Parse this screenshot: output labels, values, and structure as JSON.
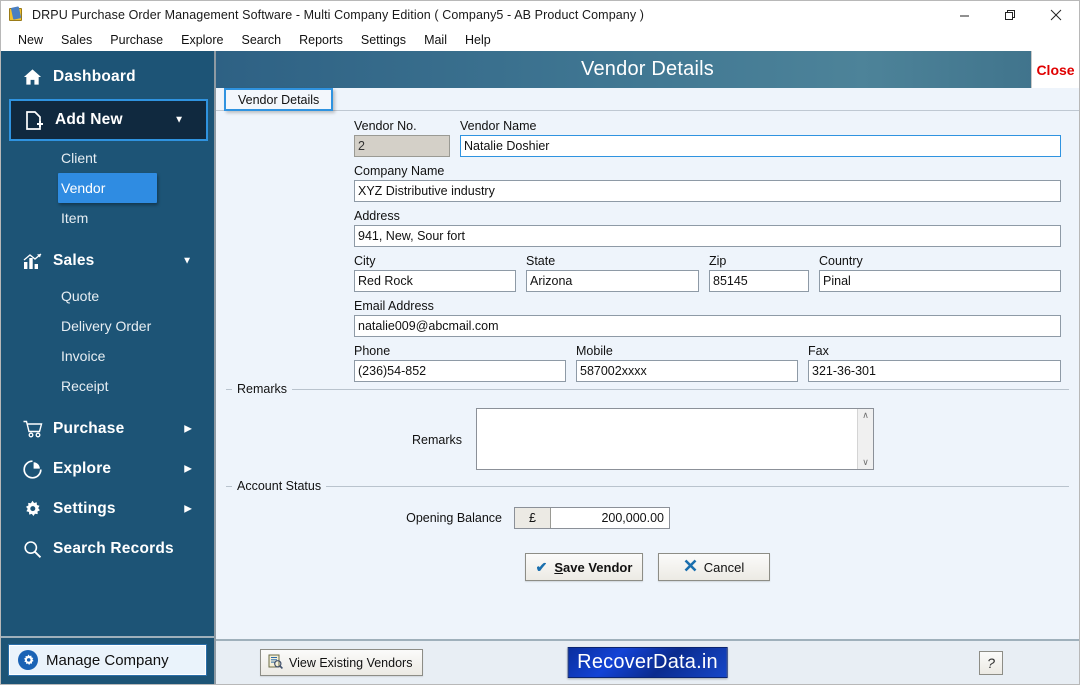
{
  "window": {
    "title": "DRPU Purchase Order Management Software - Multi Company Edition ( Company5 - AB Product Company )",
    "app_icon": "app-icon",
    "minimize": "minimize-icon",
    "maximize": "restore-icon",
    "close": "close-icon"
  },
  "menubar": {
    "items": [
      {
        "label": "New"
      },
      {
        "label": "Sales"
      },
      {
        "label": "Purchase"
      },
      {
        "label": "Explore"
      },
      {
        "label": "Search"
      },
      {
        "label": "Reports"
      },
      {
        "label": "Settings"
      },
      {
        "label": "Mail"
      },
      {
        "label": "Help"
      }
    ]
  },
  "sidebar": {
    "items": [
      {
        "label": "Dashboard",
        "icon": "home-icon",
        "type": "top",
        "caret": "",
        "selected": false
      },
      {
        "label": "Add New",
        "icon": "add-document-icon",
        "type": "top",
        "caret": "▼",
        "selected": true
      },
      {
        "label": "Client",
        "icon": "",
        "type": "sub",
        "active": false
      },
      {
        "label": "Vendor",
        "icon": "",
        "type": "sub",
        "active": true
      },
      {
        "label": "Item",
        "icon": "",
        "type": "sub",
        "active": false
      },
      {
        "label": "Sales",
        "icon": "chart-icon",
        "type": "top",
        "caret": "▼",
        "selected": false
      },
      {
        "label": "Quote",
        "icon": "",
        "type": "sub",
        "active": false
      },
      {
        "label": "Delivery Order",
        "icon": "",
        "type": "sub",
        "active": false
      },
      {
        "label": "Invoice",
        "icon": "",
        "type": "sub",
        "active": false
      },
      {
        "label": "Receipt",
        "icon": "",
        "type": "sub",
        "active": false
      },
      {
        "label": "Purchase",
        "icon": "cart-icon",
        "type": "top",
        "caret": "▶",
        "selected": false
      },
      {
        "label": "Explore",
        "icon": "pie-icon",
        "type": "top",
        "caret": "▶",
        "selected": false
      },
      {
        "label": "Settings",
        "icon": "gear-icon",
        "type": "top",
        "caret": "▶",
        "selected": false
      },
      {
        "label": "Search Records",
        "icon": "search-icon",
        "type": "top",
        "caret": "",
        "selected": false
      }
    ],
    "manage_company": {
      "label": "Manage Company",
      "icon": "gear-icon"
    }
  },
  "panel": {
    "title": "Vendor Details",
    "close_label": "Close",
    "tab_label": "Vendor Details"
  },
  "form": {
    "vendor_no": {
      "label": "Vendor No.",
      "value": "2",
      "readonly": true
    },
    "vendor_name": {
      "label": "Vendor Name",
      "value": "Natalie Doshier",
      "focused": true
    },
    "company_name": {
      "label": "Company Name",
      "value": "XYZ Distributive industry"
    },
    "address": {
      "label": "Address",
      "value": "941, New, Sour fort"
    },
    "city": {
      "label": "City",
      "value": "Red Rock"
    },
    "state": {
      "label": "State",
      "value": "Arizona"
    },
    "zip": {
      "label": "Zip",
      "value": "85145"
    },
    "country": {
      "label": "Country",
      "value": "Pinal"
    },
    "email": {
      "label": "Email Address",
      "value": "natalie009@abcmail.com"
    },
    "phone": {
      "label": "Phone",
      "value": "(236)54-852"
    },
    "mobile": {
      "label": "Mobile",
      "value": "587002xxxx"
    },
    "fax": {
      "label": "Fax",
      "value": "321-36-301"
    }
  },
  "remarks_group": {
    "title": "Remarks",
    "field_label": "Remarks",
    "value": "",
    "scroll_up": "∧",
    "scroll_down": "∨"
  },
  "account_status": {
    "title": "Account Status",
    "opening_balance_label": "Opening Balance",
    "currency_symbol": "£",
    "opening_balance_value": "200,000.00"
  },
  "actions": {
    "save_accel": "S",
    "save_rest": "ave Vendor",
    "cancel_label": "Cancel",
    "save_icon": "check-icon",
    "cancel_icon": "x-icon"
  },
  "statusbar": {
    "view_existing_label": "View Existing Vendors",
    "view_existing_icon": "list-search-icon",
    "logo_text": "RecoverData.in",
    "help_label": "?"
  },
  "colors": {
    "sidebar_bg": "#1d5476",
    "sidebar_selected_border": "#2f93e0",
    "sidebar_active_sub": "#2f8ce2",
    "panel_header": "#3f7692",
    "close_red": "#e00000",
    "logo_blue": "#1343d6",
    "form_bg": "#eef4fb"
  }
}
